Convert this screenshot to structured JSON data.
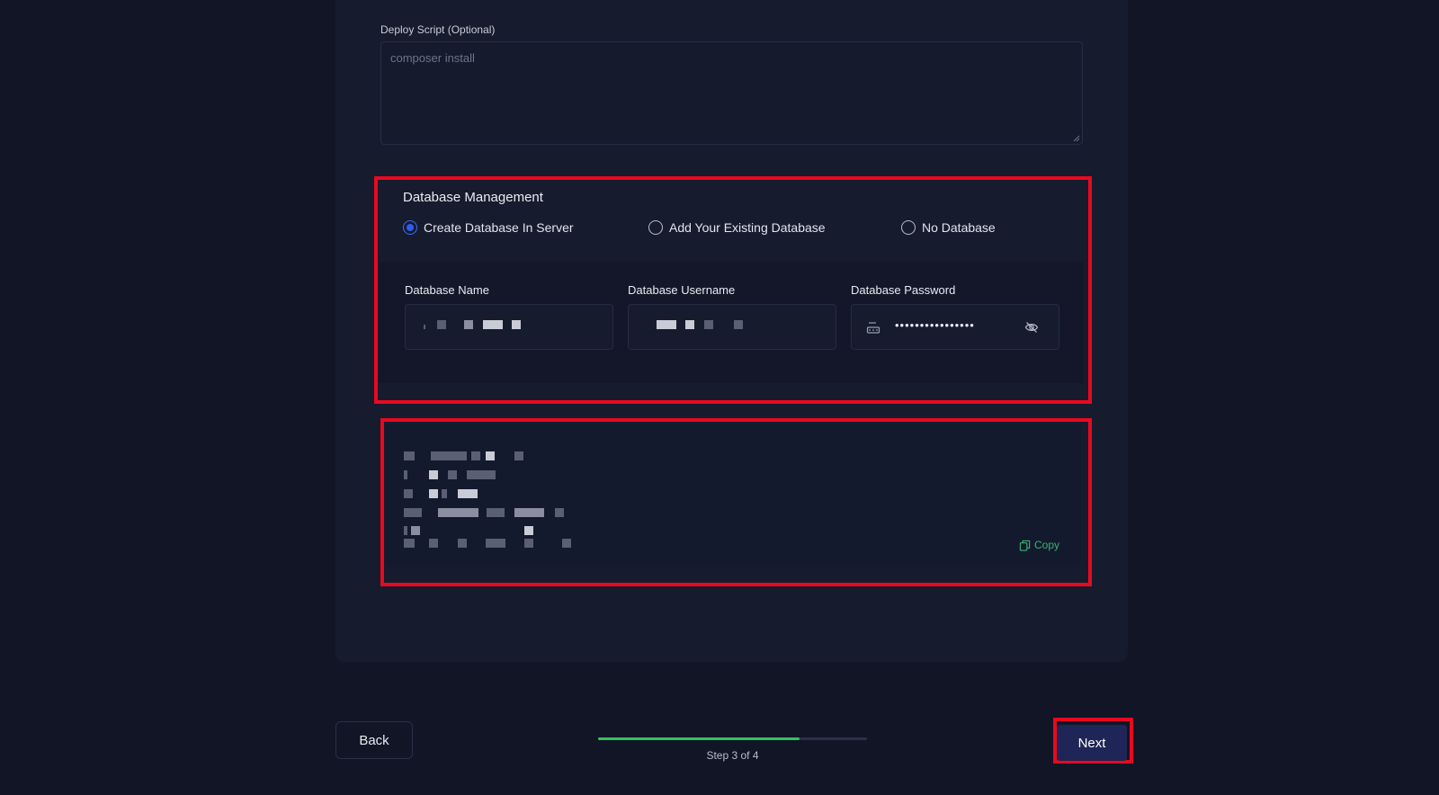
{
  "deploy_script": {
    "label": "Deploy Script (Optional)",
    "placeholder": "composer install"
  },
  "database": {
    "title": "Database Management",
    "options": [
      {
        "label": "Create Database In Server",
        "selected": true
      },
      {
        "label": "Add Your Existing Database",
        "selected": false
      },
      {
        "label": "No Database",
        "selected": false
      }
    ],
    "fields": {
      "name_label": "Database Name",
      "username_label": "Database Username",
      "password_label": "Database Password",
      "password_value": "••••••••••••••••"
    }
  },
  "credentials": {
    "copy_label": "Copy"
  },
  "footer": {
    "back_label": "Back",
    "next_label": "Next",
    "step_text": "Step 3 of 4",
    "progress": 0.75
  },
  "colors": {
    "background": "#111526",
    "card": "#161b2e",
    "accent_blue": "#2d5df0",
    "progress_green": "#38c05c",
    "copy_green": "#3bb273",
    "highlight_red": "#e8091f",
    "next_button": "#1f2557"
  }
}
